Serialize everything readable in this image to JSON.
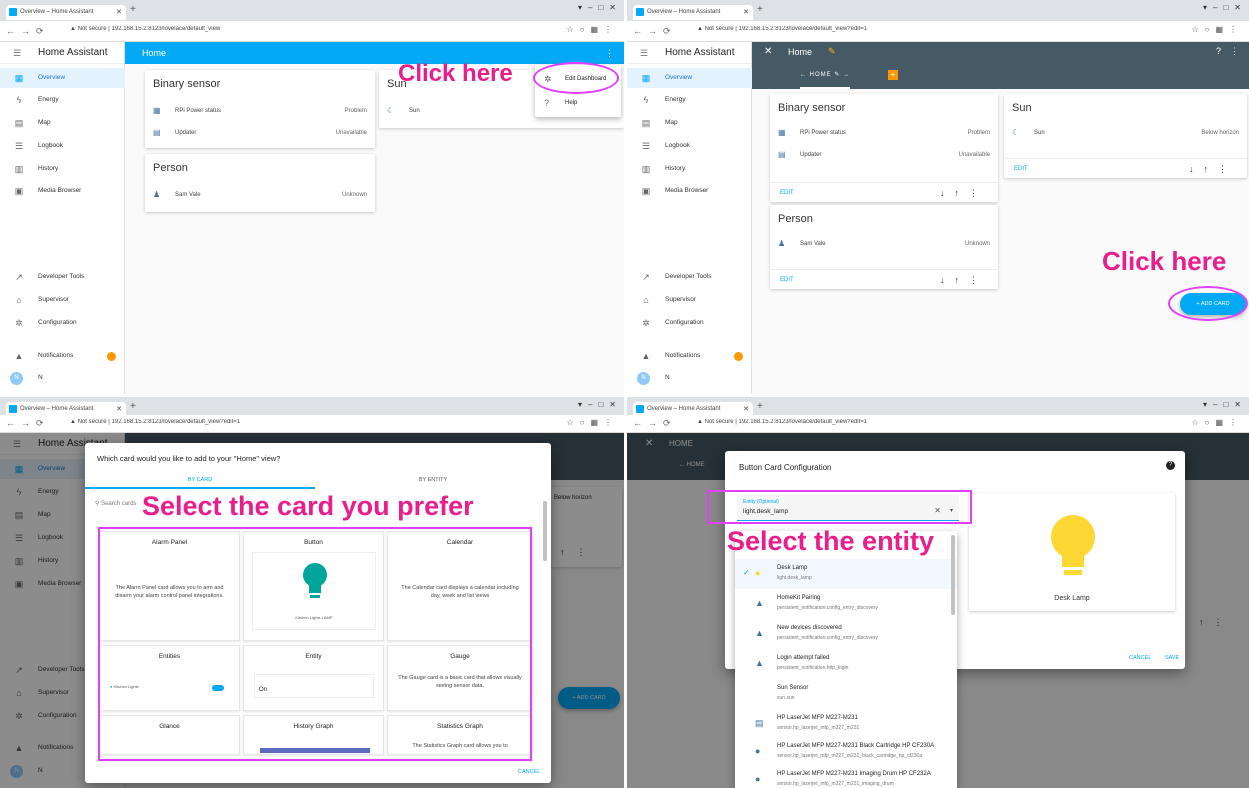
{
  "annotations": {
    "q1": "Click here",
    "q2": "Click here",
    "q3": "Select the card you prefer",
    "q4": "Select the entity"
  },
  "browser": {
    "tab_title": "Overview – Home Assistant",
    "not_secure": "Not secure",
    "url1": "192.168.15.2:8123/lovelace/default_view",
    "url3": "192.168.15.2:8123/lovelace/default_view?edit=1",
    "url4": "192.168.15.2:8123/lovelace/default_view?edit=1"
  },
  "sidebar": {
    "title": "Home Assistant",
    "items": [
      "Overview",
      "Energy",
      "Map",
      "Logbook",
      "History",
      "Media Browser"
    ],
    "bottom": [
      "Developer Tools",
      "Supervisor",
      "Configuration"
    ],
    "notifications": "Notifications",
    "user_initial": "N",
    "user_name": "N"
  },
  "q1": {
    "view_title": "Home",
    "binary_sensor": {
      "title": "Binary sensor",
      "rows": [
        {
          "name": "RPi Power status",
          "state": "Problem"
        },
        {
          "name": "Updater",
          "state": "Unavailable"
        }
      ]
    },
    "sun": {
      "title": "Sun",
      "rows": [
        {
          "name": "Sun",
          "state": ""
        }
      ]
    },
    "person": {
      "title": "Person",
      "rows": [
        {
          "name": "Sam Vale",
          "state": "Unknown"
        }
      ]
    },
    "menu": [
      "Edit Dashboard",
      "Help"
    ]
  },
  "q2": {
    "title": "Home",
    "view_tab": "HOME",
    "binary_sensor": {
      "title": "Binary sensor",
      "rows": [
        {
          "name": "RPi Power status",
          "state": "Problem"
        },
        {
          "name": "Updater",
          "state": "Unavailable"
        }
      ]
    },
    "sun": {
      "title": "Sun",
      "rows": [
        {
          "name": "Sun",
          "state": "Below horizon"
        }
      ]
    },
    "person": {
      "title": "Person",
      "rows": [
        {
          "name": "Sam Vale",
          "state": "Unknown"
        }
      ]
    },
    "edit": "EDIT",
    "add_card": "ADD CARD"
  },
  "q3": {
    "dialog_title": "Which card would you like to add to your \"Home\" view?",
    "tabs": [
      "BY CARD",
      "BY ENTITY"
    ],
    "search_placeholder": "Search cards",
    "cards": [
      {
        "name": "Alarm Panel",
        "desc": "The Alarm Panel card allows you to arm and disarm your alarm control panel integrations."
      },
      {
        "name": "Button",
        "desc": "Kitchen Lights LAMP"
      },
      {
        "name": "Calendar",
        "desc": "The Calendar card displays a calendar including day, week and list views"
      },
      {
        "name": "Entities",
        "desc": "Kitchen Lights"
      },
      {
        "name": "Entity",
        "desc": "On"
      },
      {
        "name": "Gauge",
        "desc": "The Gauge card is a basic card that allows visually seeing sensor data."
      },
      {
        "name": "Glance",
        "desc": ""
      },
      {
        "name": "History Graph",
        "desc": ""
      },
      {
        "name": "Statistics Graph",
        "desc": "The Statistics Graph card allows you to"
      }
    ],
    "cancel": "CANCEL",
    "sunset": "Below horizon",
    "add_card": "ADD CARD"
  },
  "q4": {
    "dialog_title": "Button Card Configuration",
    "entity_label": "Entity (Optional)",
    "entity_value": "light.desk_lamp",
    "preview_label": "Desk Lamp",
    "cancel": "CANCEL",
    "save": "SAVE",
    "view_tab": "HOME",
    "list": [
      {
        "name": "Desk Lamp",
        "id": "light.desk_lamp"
      },
      {
        "name": "HomeKit Pairing",
        "id": "persistent_notification.config_entry_discovery"
      },
      {
        "name": "New devices discovered",
        "id": "persistent_notification.config_entry_discovery"
      },
      {
        "name": "Login attempt failed",
        "id": "persistent_notification.http_login"
      },
      {
        "name": "Sun Sensor",
        "id": "sun.sun"
      },
      {
        "name": "HP LaserJet MFP M227-M231",
        "id": "sensor.hp_laserjet_mfp_m227_m231"
      },
      {
        "name": "HP LaserJet MFP M227-M231 Black Cartridge HP CF230A",
        "id": "sensor.hp_laserjet_mfp_m227_m231_black_cartridge_hp_cf230a"
      },
      {
        "name": "HP LaserJet MFP M227-M231 Imaging Drum HP CF232A",
        "id": "sensor.hp_laserjet_mfp_m227_m231_imaging_drum"
      }
    ]
  },
  "colors": {
    "accent": "#03a9f4",
    "header_edit": "#455a64",
    "annotation": "#e91e8c",
    "ring": "#e040fb",
    "bulb_teal": "#00a59b",
    "bulb_yellow": "#fdd835"
  }
}
